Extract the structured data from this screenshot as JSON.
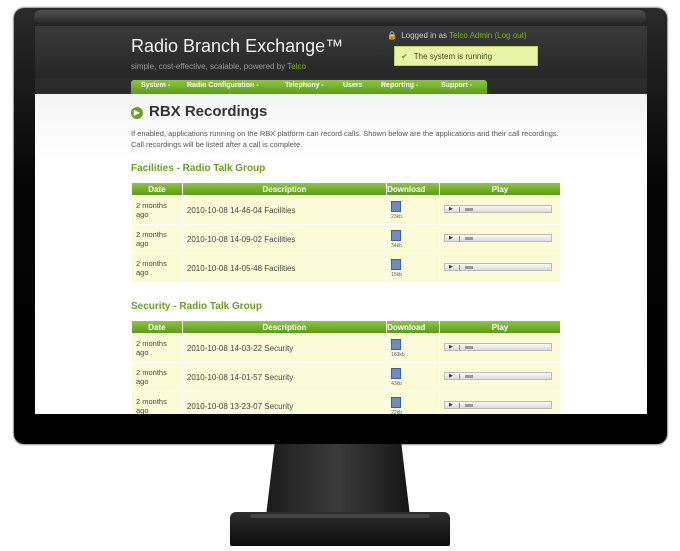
{
  "app": {
    "title": "Radio Branch Exchange™",
    "tagline": "simple, cost-effective, scalable, powered by",
    "brand": "Telco",
    "login_prefix": "Logged in as",
    "user": "Telco Admin",
    "logout": "(Log out)",
    "status": "The system is running"
  },
  "nav": [
    "System -",
    "Radio Configuration -",
    "Telephony -",
    "Users",
    "Reporting -",
    "Support -"
  ],
  "page": {
    "title": "RBX Recordings",
    "intro": "If enabled, applications running on the RBX platform can record calls. Shown below are the applications and their call recordings. Call recordings will be listed after a call is complete."
  },
  "columns": [
    "Date",
    "Description",
    "Download",
    "Play"
  ],
  "sections": [
    {
      "title": "Facilities - Radio Talk Group",
      "rows": [
        {
          "date": "2 months ago",
          "desc": "2010-10-08 14-46-04 Facilities",
          "size": "23kb"
        },
        {
          "date": "2 months ago",
          "desc": "2010-10-08 14-09-02 Facilities",
          "size": "34kb"
        },
        {
          "date": "2 months ago",
          "desc": "2010-10-08 14-05-48 Facilities",
          "size": "15kb"
        }
      ]
    },
    {
      "title": "Security - Radio Talk Group",
      "rows": [
        {
          "date": "2 months ago",
          "desc": "2010-10-08 14-03-22 Security",
          "size": "183kb"
        },
        {
          "date": "2 months ago",
          "desc": "2010-10-08 14-01-57 Security",
          "size": "43kb"
        },
        {
          "date": "2 months ago",
          "desc": "2010-10-08 13-23-07 Security",
          "size": "22kb"
        }
      ]
    }
  ],
  "colors": {
    "accent": "#6aa121",
    "row_bg": "#fbfbd8",
    "header_bg": "#2b2b2b"
  },
  "icons": [
    "lock-icon",
    "check-icon",
    "download-icon",
    "play-icon"
  ]
}
